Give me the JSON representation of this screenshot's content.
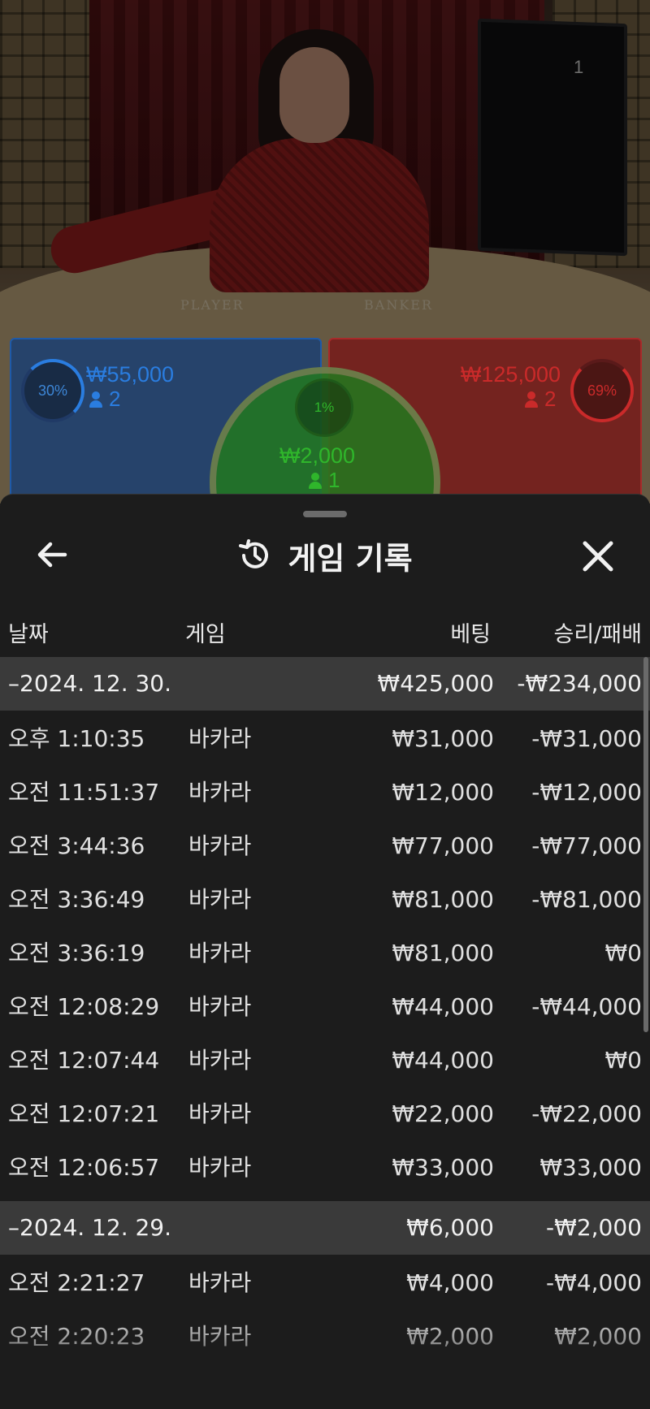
{
  "video": {
    "monitor_number": "1",
    "felt_player": "PLAYER",
    "felt_banker": "BANKER"
  },
  "bets": {
    "player": {
      "percent": "30%",
      "amount": "₩55,000",
      "count": "2",
      "color": "#2a7de0"
    },
    "tie": {
      "percent": "1%",
      "amount": "₩2,000",
      "count": "1",
      "color": "#2fb62b"
    },
    "banker": {
      "percent": "69%",
      "amount": "₩125,000",
      "count": "2",
      "color": "#ca2a2a"
    }
  },
  "panel": {
    "title": "게임 기록",
    "icons": {
      "back": "arrow-left-icon",
      "history": "history-icon",
      "close": "close-icon"
    },
    "columns": {
      "date": "날짜",
      "game": "게임",
      "bet": "베팅",
      "result": "승리/패배"
    },
    "groups": [
      {
        "date": "–2024. 12. 30.",
        "total_bet": "₩425,000",
        "total_result": "-₩234,000",
        "items": [
          {
            "time": "오후 1:10:35",
            "game": "바카라",
            "bet": "₩31,000",
            "result": "-₩31,000"
          },
          {
            "time": "오전 11:51:37",
            "game": "바카라",
            "bet": "₩12,000",
            "result": "-₩12,000"
          },
          {
            "time": "오전 3:44:36",
            "game": "바카라",
            "bet": "₩77,000",
            "result": "-₩77,000"
          },
          {
            "time": "오전 3:36:49",
            "game": "바카라",
            "bet": "₩81,000",
            "result": "-₩81,000"
          },
          {
            "time": "오전 3:36:19",
            "game": "바카라",
            "bet": "₩81,000",
            "result": "₩0"
          },
          {
            "time": "오전 12:08:29",
            "game": "바카라",
            "bet": "₩44,000",
            "result": "-₩44,000"
          },
          {
            "time": "오전 12:07:44",
            "game": "바카라",
            "bet": "₩44,000",
            "result": "₩0"
          },
          {
            "time": "오전 12:07:21",
            "game": "바카라",
            "bet": "₩22,000",
            "result": "-₩22,000"
          },
          {
            "time": "오전 12:06:57",
            "game": "바카라",
            "bet": "₩33,000",
            "result": "₩33,000"
          }
        ]
      },
      {
        "date": "–2024. 12. 29.",
        "total_bet": "₩6,000",
        "total_result": "-₩2,000",
        "items": [
          {
            "time": "오전 2:21:27",
            "game": "바카라",
            "bet": "₩4,000",
            "result": "-₩4,000"
          },
          {
            "time": "오전 2:20:23",
            "game": "바카라",
            "bet": "₩2,000",
            "result": "₩2,000"
          }
        ]
      }
    ]
  }
}
